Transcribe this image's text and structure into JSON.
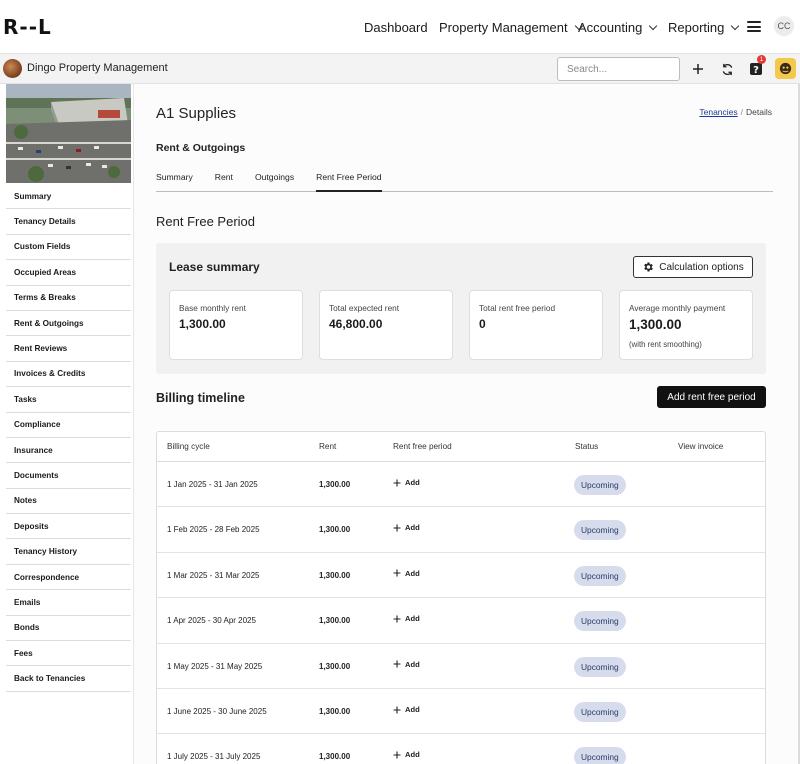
{
  "app": {
    "logo_text": "R--L",
    "user_initials": "CC"
  },
  "topnav": {
    "dashboard": "Dashboard",
    "property_management": "Property Management",
    "accounting": "Accounting",
    "reporting": "Reporting"
  },
  "subbar": {
    "org_name": "Dingo Property Management",
    "search_placeholder": "Search...",
    "help_badge": "1"
  },
  "sidebar": {
    "items": [
      "Summary",
      "Tenancy Details",
      "Custom Fields",
      "Occupied Areas",
      "Terms & Breaks",
      "Rent & Outgoings",
      "Rent Reviews",
      "Invoices & Credits",
      "Tasks",
      "Compliance",
      "Insurance",
      "Documents",
      "Notes",
      "Deposits",
      "Tenancy History",
      "Correspondence",
      "Emails",
      "Bonds",
      "Fees",
      "Back to Tenancies"
    ]
  },
  "main": {
    "title": "A1 Supplies",
    "breadcrumb": {
      "link": "Tenancies",
      "sep": "/",
      "current": "Details"
    },
    "section_title": "Rent & Outgoings",
    "tabs": [
      "Summary",
      "Rent",
      "Outgoings",
      "Rent Free Period"
    ],
    "active_tab": "Rent Free Period",
    "rfp_heading": "Rent Free Period",
    "lease_summary": {
      "title": "Lease summary",
      "calc_button": "Calculation options",
      "cards": [
        {
          "label": "Base monthly rent",
          "value": "1,300.00",
          "note": ""
        },
        {
          "label": "Total expected rent",
          "value": "46,800.00",
          "note": ""
        },
        {
          "label": "Total rent free period",
          "value": "0",
          "note": ""
        },
        {
          "label": "Average monthly payment",
          "value": "1,300.00",
          "note": "(with rent smoothing)"
        }
      ]
    },
    "billing": {
      "title": "Billing timeline",
      "add_button": "Add rent free period",
      "columns": [
        "Billing cycle",
        "Rent",
        "Rent free period",
        "Status",
        "View invoice"
      ],
      "rows": [
        {
          "cycle": "1 Jan 2025 - 31 Jan 2025",
          "rent": "1,300.00",
          "add": "Add",
          "status": "Upcoming"
        },
        {
          "cycle": "1 Feb 2025 - 28 Feb 2025",
          "rent": "1,300.00",
          "add": "Add",
          "status": "Upcoming"
        },
        {
          "cycle": "1 Mar 2025 - 31 Mar 2025",
          "rent": "1,300.00",
          "add": "Add",
          "status": "Upcoming"
        },
        {
          "cycle": "1 Apr 2025 - 30 Apr 2025",
          "rent": "1,300.00",
          "add": "Add",
          "status": "Upcoming"
        },
        {
          "cycle": "1 May 2025 - 31 May 2025",
          "rent": "1,300.00",
          "add": "Add",
          "status": "Upcoming"
        },
        {
          "cycle": "1 June 2025 - 30 June 2025",
          "rent": "1,300.00",
          "add": "Add",
          "status": "Upcoming"
        },
        {
          "cycle": "1 July 2025 - 31 July 2025",
          "rent": "1,300.00",
          "add": "Add",
          "status": "Upcoming"
        }
      ]
    }
  },
  "colors": {
    "accent_dark": "#111111",
    "status_pill_bg": "#d6dcec",
    "status_pill_text": "#2a3b6a",
    "badge_red": "#e53935",
    "link_blue": "#1f3a93"
  },
  "icons": [
    "menu-icon",
    "plus-icon",
    "refresh-icon",
    "help-icon",
    "user-avatar-icon",
    "gear-icon",
    "plus-small-icon"
  ]
}
